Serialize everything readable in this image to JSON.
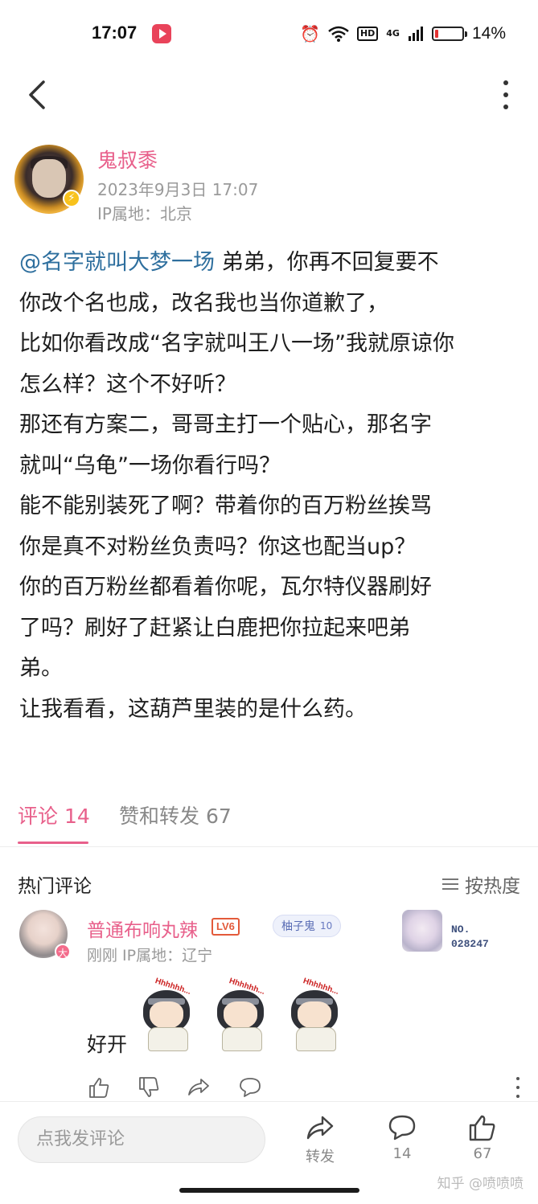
{
  "status_bar": {
    "time": "17:07",
    "network": "4G",
    "hd_label": "HD",
    "battery_percent_text": "14%",
    "battery_level": 0.14,
    "icons": [
      "youtube-icon",
      "alarm-icon",
      "wifi-icon",
      "hd-icon",
      "signal-icon",
      "battery-icon"
    ]
  },
  "nav": {
    "back_icon": "chevron-left-icon",
    "more_icon": "vertical-dots-icon"
  },
  "post": {
    "author": "鬼叔黍",
    "date": "2023年9月3日 17:07",
    "ip": "IP属地：北京",
    "mention": "@名字就叫大梦一场",
    "lines": [
      " 弟弟，你再不回复要不",
      "你改个名也成，改名我也当你道歉了，",
      "比如你看改成“名字就叫王八一场”我就原谅你",
      "怎么样？这个不好听？",
      "那还有方案二，哥哥主打一个贴心，那名字",
      "就叫“乌龟”一场你看行吗？",
      "能不能别装死了啊？带着你的百万粉丝挨骂",
      "你是真不对粉丝负责吗？你这也配当up？",
      "你的百万粉丝都看着你呢，瓦尔特仪器刷好",
      "了吗？刷好了赶紧让白鹿把你拉起来吧弟",
      "弟。",
      "让我看看，这葫芦里装的是什么药。"
    ]
  },
  "tabs": [
    {
      "label": "评论 14",
      "active": true
    },
    {
      "label": "赞和转发 67",
      "active": false
    }
  ],
  "comments_section": {
    "title": "热门评论",
    "sort_label": "按热度",
    "comment": {
      "author": "普通布响丸辣",
      "level_badge": "LV6",
      "fan_badge_name": "柚子鬼",
      "fan_badge_level": "10",
      "avatar_badge": "大",
      "meta": "刚刚 IP属地：辽宁",
      "deco_no": "NO.",
      "deco_id": "028247",
      "text": "好开",
      "sticker_text": "Hhhhhh...",
      "sticker_count": 3
    }
  },
  "bottom_bar": {
    "input_placeholder": "点我发评论",
    "repost_label": "转发",
    "comment_count": "14",
    "like_count": "67"
  },
  "watermark": "知乎 @喷喷喷",
  "colors": {
    "accent_pink": "#e8608b",
    "mention_blue": "#2e6f9e",
    "battery_low": "#e33333"
  }
}
